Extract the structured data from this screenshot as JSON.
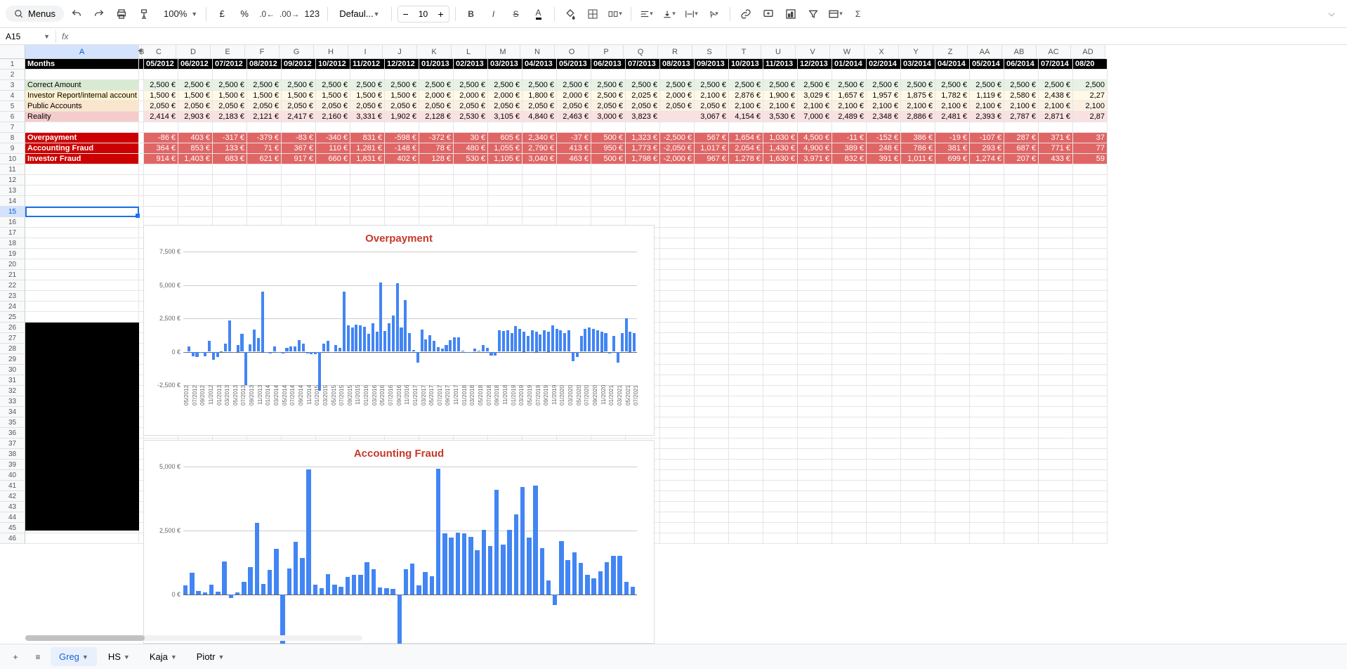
{
  "toolbar": {
    "menus": "Menus",
    "zoom": "100%",
    "currency": "£",
    "percent": "%",
    "fmt123": "123",
    "font": "Defaul...",
    "size": "10"
  },
  "name_box": "A15",
  "fx": "fx",
  "columns": [
    "A",
    "B",
    "C",
    "D",
    "E",
    "F",
    "G",
    "H",
    "I",
    "J",
    "K",
    "L",
    "M",
    "N",
    "O",
    "P",
    "Q",
    "R",
    "S",
    "T",
    "U",
    "V",
    "W",
    "X",
    "Y",
    "Z",
    "AA",
    "AB",
    "AC",
    "AD"
  ],
  "row_count": 46,
  "selected_row": 15,
  "months": [
    "05/2012",
    "06/2012",
    "07/2012",
    "08/2012",
    "09/2012",
    "10/2012",
    "11/2012",
    "12/2012",
    "01/2013",
    "02/2013",
    "03/2013",
    "04/2013",
    "05/2013",
    "06/2013",
    "07/2013",
    "08/2013",
    "09/2013",
    "10/2013",
    "11/2013",
    "12/2013",
    "01/2014",
    "02/2014",
    "03/2014",
    "04/2014",
    "05/2014",
    "06/2014",
    "07/2014",
    "08/20"
  ],
  "labels": {
    "title": "Months",
    "correct": "Correct Amount",
    "investor": "Investor Report/internal account",
    "public": "Public Accounts",
    "reality": "Reality",
    "over": "Overpayment",
    "afraud": "Accounting Fraud",
    "ifraud": "Investor Fraud"
  },
  "rows": {
    "correct": [
      "2,500 €",
      "2,500 €",
      "2,500 €",
      "2,500 €",
      "2,500 €",
      "2,500 €",
      "2,500 €",
      "2,500 €",
      "2,500 €",
      "2,500 €",
      "2,500 €",
      "2,500 €",
      "2,500 €",
      "2,500 €",
      "2,500 €",
      "2,500 €",
      "2,500 €",
      "2,500 €",
      "2,500 €",
      "2,500 €",
      "2,500 €",
      "2,500 €",
      "2,500 €",
      "2,500 €",
      "2,500 €",
      "2,500 €",
      "2,500 €",
      "2,500"
    ],
    "investor": [
      "1,500 €",
      "1,500 €",
      "1,500 €",
      "1,500 €",
      "1,500 €",
      "1,500 €",
      "1,500 €",
      "1,500 €",
      "2,000 €",
      "2,000 €",
      "2,000 €",
      "1,800 €",
      "2,000 €",
      "2,500 €",
      "2,025 €",
      "2,000 €",
      "2,100 €",
      "2,876 €",
      "1,900 €",
      "3,029 €",
      "1,657 €",
      "1,957 €",
      "1,875 €",
      "1,782 €",
      "1,119 €",
      "2,580 €",
      "2,438 €",
      "2,27"
    ],
    "public": [
      "2,050 €",
      "2,050 €",
      "2,050 €",
      "2,050 €",
      "2,050 €",
      "2,050 €",
      "2,050 €",
      "2,050 €",
      "2,050 €",
      "2,050 €",
      "2,050 €",
      "2,050 €",
      "2,050 €",
      "2,050 €",
      "2,050 €",
      "2,050 €",
      "2,050 €",
      "2,100 €",
      "2,100 €",
      "2,100 €",
      "2,100 €",
      "2,100 €",
      "2,100 €",
      "2,100 €",
      "2,100 €",
      "2,100 €",
      "2,100 €",
      "2,100"
    ],
    "reality": [
      "2,414 €",
      "2,903 €",
      "2,183 €",
      "2,121 €",
      "2,417 €",
      "2,160 €",
      "3,331 €",
      "1,902 €",
      "2,128 €",
      "2,530 €",
      "3,105 €",
      "4,840 €",
      "2,463 €",
      "3,000 €",
      "3,823 €",
      "",
      "3,067 €",
      "4,154 €",
      "3,530 €",
      "7,000 €",
      "2,489 €",
      "2,348 €",
      "2,886 €",
      "2,481 €",
      "2,393 €",
      "2,787 €",
      "2,871 €",
      "2,87"
    ],
    "over": [
      "-86 €",
      "403 €",
      "-317 €",
      "-379 €",
      "-83 €",
      "-340 €",
      "831 €",
      "-598 €",
      "-372 €",
      "30 €",
      "605 €",
      "2,340 €",
      "-37 €",
      "500 €",
      "1,323 €",
      "-2,500 €",
      "567 €",
      "1,654 €",
      "1,030 €",
      "4,500 €",
      "-11 €",
      "-152 €",
      "386 €",
      "-19 €",
      "-107 €",
      "287 €",
      "371 €",
      "37"
    ],
    "afraud": [
      "364 €",
      "853 €",
      "133 €",
      "71 €",
      "367 €",
      "110 €",
      "1,281 €",
      "-148 €",
      "78 €",
      "480 €",
      "1,055 €",
      "2,790 €",
      "413 €",
      "950 €",
      "1,773 €",
      "-2,050 €",
      "1,017 €",
      "2,054 €",
      "1,430 €",
      "4,900 €",
      "389 €",
      "248 €",
      "786 €",
      "381 €",
      "293 €",
      "687 €",
      "771 €",
      "77"
    ],
    "ifraud": [
      "914 €",
      "1,403 €",
      "683 €",
      "621 €",
      "917 €",
      "660 €",
      "1,831 €",
      "402 €",
      "128 €",
      "530 €",
      "1,105 €",
      "3,040 €",
      "463 €",
      "500 €",
      "1,798 €",
      "-2,000 €",
      "967 €",
      "1,278 €",
      "1,630 €",
      "3,971 €",
      "832 €",
      "391 €",
      "1,011 €",
      "699 €",
      "1,274 €",
      "207 €",
      "433 €",
      "59"
    ]
  },
  "tabs": [
    {
      "name": "Greg",
      "active": true
    },
    {
      "name": "HS",
      "active": false
    },
    {
      "name": "Kaja",
      "active": false
    },
    {
      "name": "Piotr",
      "active": false
    }
  ],
  "chart_data": [
    {
      "type": "bar",
      "title": "Overpayment",
      "y_ticks": [
        -2500,
        0,
        2500,
        5000,
        7500
      ],
      "y_tick_labels": [
        "-2,500 €",
        "0 €",
        "2,500 €",
        "5,000 €",
        "7,500 €"
      ],
      "ymin": -2500,
      "ymax": 7500,
      "x_labels_every2": [
        "05/2012",
        "07/2012",
        "09/2012",
        "11/2012",
        "01/2013",
        "03/2013",
        "05/2013",
        "07/2013",
        "09/2013",
        "11/2013",
        "01/2014",
        "03/2014",
        "05/2014",
        "07/2014",
        "09/2014",
        "11/2014",
        "01/2015",
        "03/2015",
        "05/2015",
        "07/2015",
        "09/2015",
        "11/2015",
        "01/2016",
        "03/2016",
        "05/2016",
        "07/2016",
        "09/2016",
        "11/2016",
        "01/2017",
        "03/2017",
        "05/2017",
        "07/2017",
        "09/2017",
        "11/2017",
        "01/2018",
        "03/2018",
        "05/2018",
        "07/2018",
        "09/2018",
        "11/2018",
        "01/2019",
        "03/2019",
        "05/2019",
        "07/2019",
        "09/2019",
        "11/2019",
        "01/2020",
        "03/2020",
        "05/2020",
        "07/2020",
        "09/2020",
        "11/2020",
        "01/2021",
        "03/2021",
        "05/2021",
        "07/2021"
      ],
      "values": [
        -86,
        403,
        -317,
        -379,
        -83,
        -340,
        831,
        -598,
        -372,
        30,
        605,
        2340,
        -37,
        500,
        1323,
        -2500,
        567,
        1654,
        1030,
        4500,
        -11,
        -152,
        386,
        -19,
        -107,
        287,
        371,
        373,
        867,
        597,
        -140,
        -162,
        -192,
        -2939,
        594,
        800,
        -50,
        476,
        300,
        4518,
        1980,
        1831,
        2026,
        1980,
        1858,
        1334,
        2112,
        1503,
        5173,
        1540,
        2132,
        2736,
        5107,
        1826,
        3861,
        1411,
        151,
        -823,
        1682,
        936,
        1253,
        822,
        368,
        224,
        490,
        850,
        1096,
        1102,
        97,
        -91,
        -52,
        246,
        70,
        506,
        300,
        -300,
        -300,
        1604,
        1552,
        1600,
        1400,
        1921,
        1700,
        1500,
        1200,
        1600,
        1500,
        1275,
        1600,
        1500,
        1964,
        1700,
        1600,
        1400,
        1600,
        -699,
        -400,
        1188,
        1700,
        1800,
        1700,
        1600,
        1500,
        1400,
        -150,
        1200,
        -798,
        1400,
        2480,
        1500,
        1400
      ]
    },
    {
      "type": "bar",
      "title": "Accounting Fraud",
      "y_ticks": [
        0,
        2500,
        5000
      ],
      "y_tick_labels": [
        "0 €",
        "2,500 €",
        "5,000 €"
      ],
      "ymin": -500,
      "ymax": 5000,
      "values": [
        364,
        853,
        133,
        71,
        367,
        110,
        1281,
        -148,
        78,
        480,
        1055,
        2790,
        413,
        950,
        1773,
        -2050,
        1017,
        2054,
        1430,
        4900,
        389,
        248,
        786,
        381,
        293,
        687,
        771,
        773,
        1267,
        997,
        260,
        238,
        208,
        -2539,
        994,
        1200,
        350,
        876,
        700,
        4918,
        2380,
        2231,
        2426,
        2380,
        2258,
        1734,
        2512,
        1903,
        4100,
        1940,
        2532,
        3136,
        4200,
        2226,
        4261,
        1811,
        551,
        -423,
        2082,
        1336,
        1653,
        1222,
        768,
        624,
        890,
        1250,
        1496,
        1502,
        497,
        309
      ]
    }
  ],
  "add_sheet": "+",
  "all_sheets": "≡"
}
